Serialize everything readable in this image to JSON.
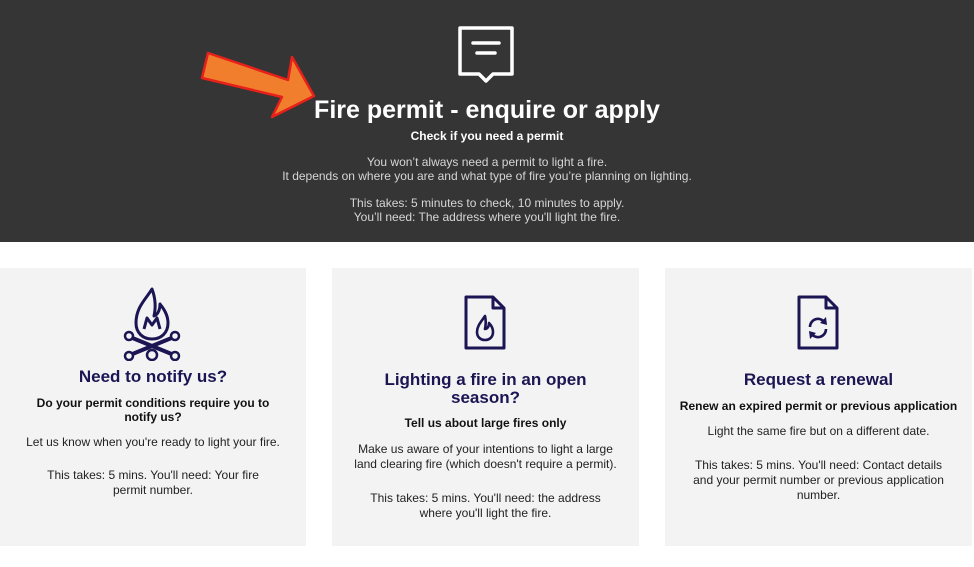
{
  "hero": {
    "icon": "message-icon",
    "title": "Fire permit - enquire or apply",
    "subtitle": "Check if you need a permit",
    "intro_line1": "You won’t always need a permit to light a fire.",
    "intro_line2": "It depends on where you are and what type of fire you’re planning on lighting.",
    "takes_line": "This takes: 5 minutes to check, 10 minutes to apply.",
    "need_line": "You’ll need: The address where you'll light the fire."
  },
  "annotation": {
    "icon": "arrow-icon",
    "color": "#f07e2c",
    "outline": "#e8201a"
  },
  "colors": {
    "hero_bg": "#353535",
    "card_bg": "#f3f3f3",
    "accent": "#1b1553"
  },
  "cards": [
    {
      "icon": "campfire-icon",
      "title": "Need to notify us?",
      "subtitle": "Do your permit conditions require you to notify us?",
      "description": "Let us know when you're ready to light your fire.",
      "details": "This takes: 5 mins. You'll need: Your fire permit number."
    },
    {
      "icon": "fire-document-icon",
      "title": "Lighting a fire in an open season?",
      "subtitle": "Tell us about large fires only",
      "description": "Make us aware of your intentions to light a large land clearing fire (which doesn't require a permit).",
      "details": "This takes: 5 mins. You'll need: the address where you'll light the fire."
    },
    {
      "icon": "renew-document-icon",
      "title": "Request a renewal",
      "subtitle": "Renew an expired permit or previous application",
      "description": "Light the same fire but on a different date.",
      "details": "This takes: 5 mins. You'll need: Contact details and your permit number or previous application number."
    }
  ]
}
